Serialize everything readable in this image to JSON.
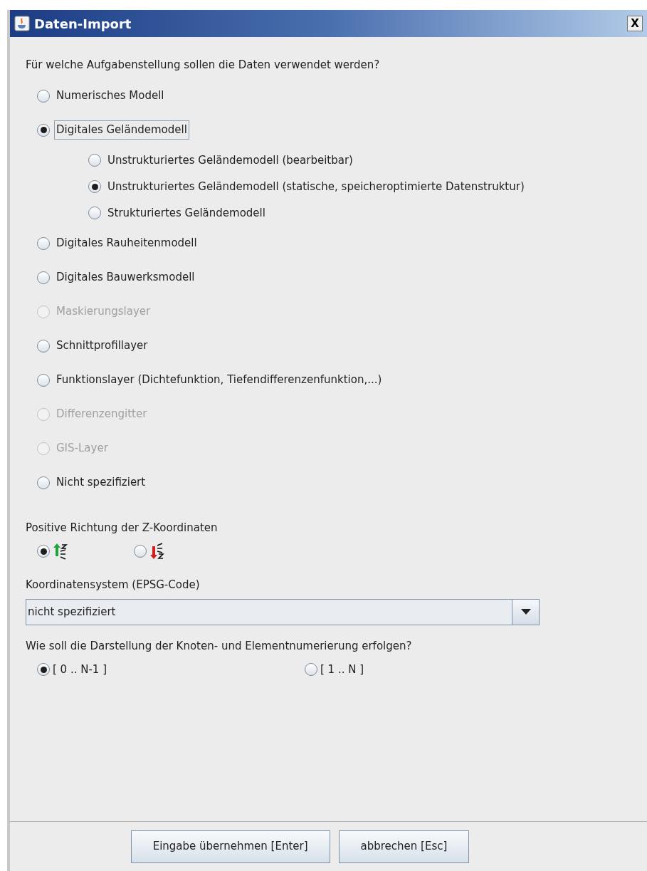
{
  "window": {
    "title": "Daten-Import",
    "close": "X"
  },
  "task_question": "Für welche Aufgabenstellung sollen die Daten verwendet werden?",
  "task_options": [
    {
      "label": "Numerisches Modell",
      "selected": false,
      "disabled": false,
      "focused": false
    },
    {
      "label": "Digitales Geländemodell",
      "selected": true,
      "disabled": false,
      "focused": true,
      "children": [
        {
          "label": "Unstrukturiertes Geländemodell (bearbeitbar)",
          "selected": false,
          "disabled": false,
          "focused": false
        },
        {
          "label": "Unstrukturiertes Geländemodell (statische, speicheroptimierte Datenstruktur)",
          "selected": true,
          "disabled": false,
          "focused": false
        },
        {
          "label": "Strukturiertes Geländemodell",
          "selected": false,
          "disabled": false,
          "focused": false
        }
      ]
    },
    {
      "label": "Digitales Rauheitenmodell",
      "selected": false,
      "disabled": false,
      "focused": false
    },
    {
      "label": "Digitales Bauwerksmodell",
      "selected": false,
      "disabled": false,
      "focused": false
    },
    {
      "label": "Maskierungslayer",
      "selected": false,
      "disabled": true,
      "focused": false
    },
    {
      "label": "Schnittprofillayer",
      "selected": false,
      "disabled": false,
      "focused": false
    },
    {
      "label": "Funktionslayer (Dichtefunktion, Tiefendifferenzenfunktion,...)",
      "selected": false,
      "disabled": false,
      "focused": false
    },
    {
      "label": "Differenzengitter",
      "selected": false,
      "disabled": true,
      "focused": false
    },
    {
      "label": "GIS-Layer",
      "selected": false,
      "disabled": true,
      "focused": false
    },
    {
      "label": "Nicht spezifiziert",
      "selected": false,
      "disabled": false,
      "focused": false
    }
  ],
  "z_direction": {
    "label": "Positive Richtung der Z-Koordinaten",
    "options": [
      {
        "kind": "up",
        "selected": true
      },
      {
        "kind": "down",
        "selected": false
      }
    ]
  },
  "coordinate_system": {
    "label": "Koordinatensystem (EPSG-Code)",
    "value": "nicht spezifiziert"
  },
  "numbering": {
    "label": "Wie soll die Darstellung der Knoten- und Elementnumerierung erfolgen?",
    "options": [
      {
        "label": "[ 0 .. N-1 ]",
        "selected": true
      },
      {
        "label": "[ 1 .. N ]",
        "selected": false
      }
    ]
  },
  "buttons": [
    "Eingabe übernehmen [Enter]",
    "abbrechen [Esc]"
  ]
}
